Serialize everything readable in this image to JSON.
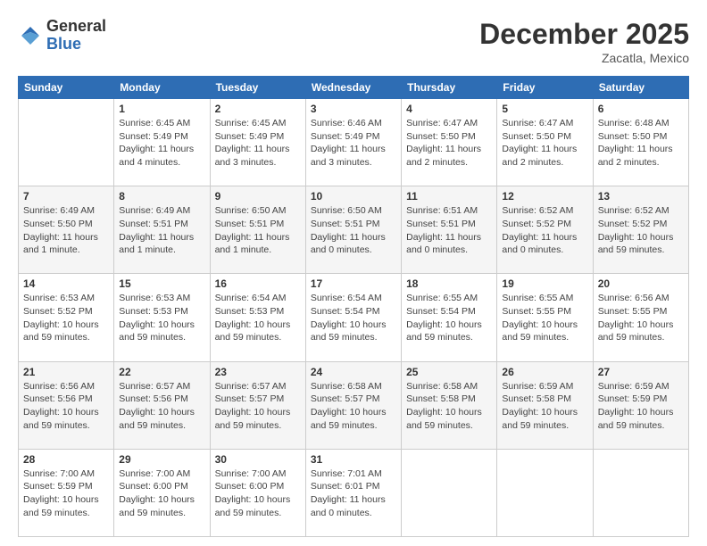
{
  "logo": {
    "general": "General",
    "blue": "Blue"
  },
  "header": {
    "month_title": "December 2025",
    "location": "Zacatla, Mexico"
  },
  "weekdays": [
    "Sunday",
    "Monday",
    "Tuesday",
    "Wednesday",
    "Thursday",
    "Friday",
    "Saturday"
  ],
  "weeks": [
    [
      {
        "day": "",
        "info": ""
      },
      {
        "day": "1",
        "info": "Sunrise: 6:45 AM\nSunset: 5:49 PM\nDaylight: 11 hours\nand 4 minutes."
      },
      {
        "day": "2",
        "info": "Sunrise: 6:45 AM\nSunset: 5:49 PM\nDaylight: 11 hours\nand 3 minutes."
      },
      {
        "day": "3",
        "info": "Sunrise: 6:46 AM\nSunset: 5:49 PM\nDaylight: 11 hours\nand 3 minutes."
      },
      {
        "day": "4",
        "info": "Sunrise: 6:47 AM\nSunset: 5:50 PM\nDaylight: 11 hours\nand 2 minutes."
      },
      {
        "day": "5",
        "info": "Sunrise: 6:47 AM\nSunset: 5:50 PM\nDaylight: 11 hours\nand 2 minutes."
      },
      {
        "day": "6",
        "info": "Sunrise: 6:48 AM\nSunset: 5:50 PM\nDaylight: 11 hours\nand 2 minutes."
      }
    ],
    [
      {
        "day": "7",
        "info": "Sunrise: 6:49 AM\nSunset: 5:50 PM\nDaylight: 11 hours\nand 1 minute."
      },
      {
        "day": "8",
        "info": "Sunrise: 6:49 AM\nSunset: 5:51 PM\nDaylight: 11 hours\nand 1 minute."
      },
      {
        "day": "9",
        "info": "Sunrise: 6:50 AM\nSunset: 5:51 PM\nDaylight: 11 hours\nand 1 minute."
      },
      {
        "day": "10",
        "info": "Sunrise: 6:50 AM\nSunset: 5:51 PM\nDaylight: 11 hours\nand 0 minutes."
      },
      {
        "day": "11",
        "info": "Sunrise: 6:51 AM\nSunset: 5:51 PM\nDaylight: 11 hours\nand 0 minutes."
      },
      {
        "day": "12",
        "info": "Sunrise: 6:52 AM\nSunset: 5:52 PM\nDaylight: 11 hours\nand 0 minutes."
      },
      {
        "day": "13",
        "info": "Sunrise: 6:52 AM\nSunset: 5:52 PM\nDaylight: 10 hours\nand 59 minutes."
      }
    ],
    [
      {
        "day": "14",
        "info": "Sunrise: 6:53 AM\nSunset: 5:52 PM\nDaylight: 10 hours\nand 59 minutes."
      },
      {
        "day": "15",
        "info": "Sunrise: 6:53 AM\nSunset: 5:53 PM\nDaylight: 10 hours\nand 59 minutes."
      },
      {
        "day": "16",
        "info": "Sunrise: 6:54 AM\nSunset: 5:53 PM\nDaylight: 10 hours\nand 59 minutes."
      },
      {
        "day": "17",
        "info": "Sunrise: 6:54 AM\nSunset: 5:54 PM\nDaylight: 10 hours\nand 59 minutes."
      },
      {
        "day": "18",
        "info": "Sunrise: 6:55 AM\nSunset: 5:54 PM\nDaylight: 10 hours\nand 59 minutes."
      },
      {
        "day": "19",
        "info": "Sunrise: 6:55 AM\nSunset: 5:55 PM\nDaylight: 10 hours\nand 59 minutes."
      },
      {
        "day": "20",
        "info": "Sunrise: 6:56 AM\nSunset: 5:55 PM\nDaylight: 10 hours\nand 59 minutes."
      }
    ],
    [
      {
        "day": "21",
        "info": "Sunrise: 6:56 AM\nSunset: 5:56 PM\nDaylight: 10 hours\nand 59 minutes."
      },
      {
        "day": "22",
        "info": "Sunrise: 6:57 AM\nSunset: 5:56 PM\nDaylight: 10 hours\nand 59 minutes."
      },
      {
        "day": "23",
        "info": "Sunrise: 6:57 AM\nSunset: 5:57 PM\nDaylight: 10 hours\nand 59 minutes."
      },
      {
        "day": "24",
        "info": "Sunrise: 6:58 AM\nSunset: 5:57 PM\nDaylight: 10 hours\nand 59 minutes."
      },
      {
        "day": "25",
        "info": "Sunrise: 6:58 AM\nSunset: 5:58 PM\nDaylight: 10 hours\nand 59 minutes."
      },
      {
        "day": "26",
        "info": "Sunrise: 6:59 AM\nSunset: 5:58 PM\nDaylight: 10 hours\nand 59 minutes."
      },
      {
        "day": "27",
        "info": "Sunrise: 6:59 AM\nSunset: 5:59 PM\nDaylight: 10 hours\nand 59 minutes."
      }
    ],
    [
      {
        "day": "28",
        "info": "Sunrise: 7:00 AM\nSunset: 5:59 PM\nDaylight: 10 hours\nand 59 minutes."
      },
      {
        "day": "29",
        "info": "Sunrise: 7:00 AM\nSunset: 6:00 PM\nDaylight: 10 hours\nand 59 minutes."
      },
      {
        "day": "30",
        "info": "Sunrise: 7:00 AM\nSunset: 6:00 PM\nDaylight: 10 hours\nand 59 minutes."
      },
      {
        "day": "31",
        "info": "Sunrise: 7:01 AM\nSunset: 6:01 PM\nDaylight: 11 hours\nand 0 minutes."
      },
      {
        "day": "",
        "info": ""
      },
      {
        "day": "",
        "info": ""
      },
      {
        "day": "",
        "info": ""
      }
    ]
  ]
}
